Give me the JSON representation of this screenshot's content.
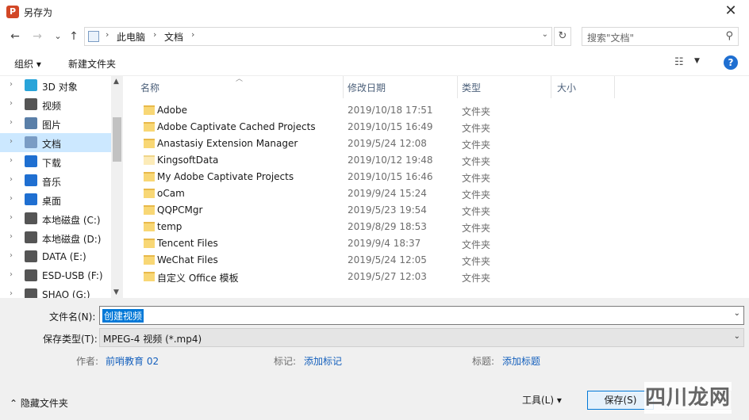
{
  "window": {
    "app_icon_letter": "P",
    "title": "另存为",
    "close_glyph": "✕"
  },
  "nav": {
    "back": "←",
    "forward": "→",
    "recent": "⌄",
    "up": "↑",
    "address": [
      {
        "label": "此电脑"
      },
      {
        "label": "文档"
      }
    ],
    "refresh": "↻",
    "search_placeholder": "搜索\"文档\""
  },
  "toolbar": {
    "organize": "组织 ▾",
    "new_folder": "新建文件夹",
    "help": "?"
  },
  "sidebar": {
    "items": [
      {
        "label": "3D 对象",
        "icon": "cube-icon",
        "color": "#29a4d9"
      },
      {
        "label": "视频",
        "icon": "film-icon",
        "color": "#555555"
      },
      {
        "label": "图片",
        "icon": "picture-icon",
        "color": "#5a7fa8"
      },
      {
        "label": "文档",
        "icon": "document-icon",
        "color": "#7a9cc4",
        "selected": true
      },
      {
        "label": "下载",
        "icon": "download-icon",
        "color": "#1f6fd1"
      },
      {
        "label": "音乐",
        "icon": "music-icon",
        "color": "#1f6fd1"
      },
      {
        "label": "桌面",
        "icon": "desktop-icon",
        "color": "#1f6fd1"
      },
      {
        "label": "本地磁盘 (C:)",
        "icon": "drive-icon",
        "color": "#555555"
      },
      {
        "label": "本地磁盘 (D:)",
        "icon": "drive-icon",
        "color": "#555555"
      },
      {
        "label": "DATA (E:)",
        "icon": "drive-icon",
        "color": "#555555"
      },
      {
        "label": "ESD-USB (F:)",
        "icon": "usb-icon",
        "color": "#555555"
      },
      {
        "label": "SHAO (G:)",
        "icon": "drive-icon",
        "color": "#555555"
      }
    ]
  },
  "columns": {
    "name": "名称",
    "date": "修改日期",
    "type": "类型",
    "size": "大小"
  },
  "files": [
    {
      "name": "Adobe",
      "date": "2019/10/18 17:51",
      "type": "文件夹"
    },
    {
      "name": "Adobe Captivate Cached Projects",
      "date": "2019/10/15 16:49",
      "type": "文件夹"
    },
    {
      "name": "Anastasiy Extension Manager",
      "date": "2019/5/24 12:08",
      "type": "文件夹"
    },
    {
      "name": "KingsoftData",
      "date": "2019/10/12 19:48",
      "type": "文件夹",
      "light": true
    },
    {
      "name": "My Adobe Captivate Projects",
      "date": "2019/10/15 16:46",
      "type": "文件夹"
    },
    {
      "name": "oCam",
      "date": "2019/9/24 15:24",
      "type": "文件夹"
    },
    {
      "name": "QQPCMgr",
      "date": "2019/5/23 19:54",
      "type": "文件夹"
    },
    {
      "name": "temp",
      "date": "2019/8/29 18:53",
      "type": "文件夹"
    },
    {
      "name": "Tencent Files",
      "date": "2019/9/4 18:37",
      "type": "文件夹"
    },
    {
      "name": "WeChat Files",
      "date": "2019/5/24 12:05",
      "type": "文件夹"
    },
    {
      "name": "自定义 Office 模板",
      "date": "2019/5/27 12:03",
      "type": "文件夹"
    }
  ],
  "form": {
    "filename_label": "文件名(N):",
    "filename_value": "创建视频",
    "filetype_label": "保存类型(T):",
    "filetype_value": "MPEG-4 视频 (*.mp4)",
    "author_label": "作者:",
    "author_value": "前哨教育 02",
    "tags_label": "标记:",
    "tags_value": "添加标记",
    "title_label": "标题:",
    "title_value": "添加标题"
  },
  "footer": {
    "hide_folders": "隐藏文件夹",
    "tools": "工具(L)  ▾",
    "save": "保存(S)"
  },
  "watermark": "四川龙网"
}
